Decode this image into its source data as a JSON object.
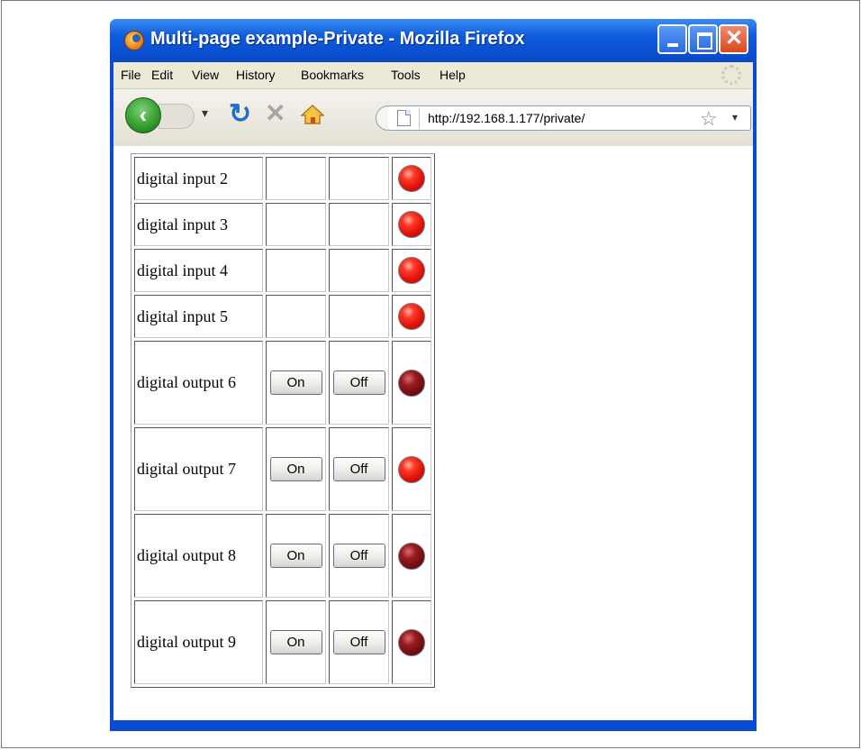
{
  "window": {
    "title": "Multi-page example-Private - Mozilla Firefox"
  },
  "menubar": {
    "items": [
      "File",
      "Edit",
      "View",
      "History",
      "Bookmarks",
      "Tools",
      "Help"
    ]
  },
  "navbar": {
    "url": "http://192.168.1.177/private/"
  },
  "table": {
    "inputs": [
      {
        "label": "digital input 2",
        "led": "on"
      },
      {
        "label": "digital input 3",
        "led": "on"
      },
      {
        "label": "digital input 4",
        "led": "on"
      },
      {
        "label": "digital input 5",
        "led": "on"
      }
    ],
    "outputs": [
      {
        "label": "digital output 6",
        "on_label": "On",
        "off_label": "Off",
        "led": "off"
      },
      {
        "label": "digital output 7",
        "on_label": "On",
        "off_label": "Off",
        "led": "on"
      },
      {
        "label": "digital output 8",
        "on_label": "On",
        "off_label": "Off",
        "led": "off"
      },
      {
        "label": "digital output 9",
        "on_label": "On",
        "off_label": "Off",
        "led": "off"
      }
    ]
  },
  "colors": {
    "led_on": "#ff3a2a",
    "led_off": "#7a1018",
    "titlebar": "#0d5bdc"
  }
}
